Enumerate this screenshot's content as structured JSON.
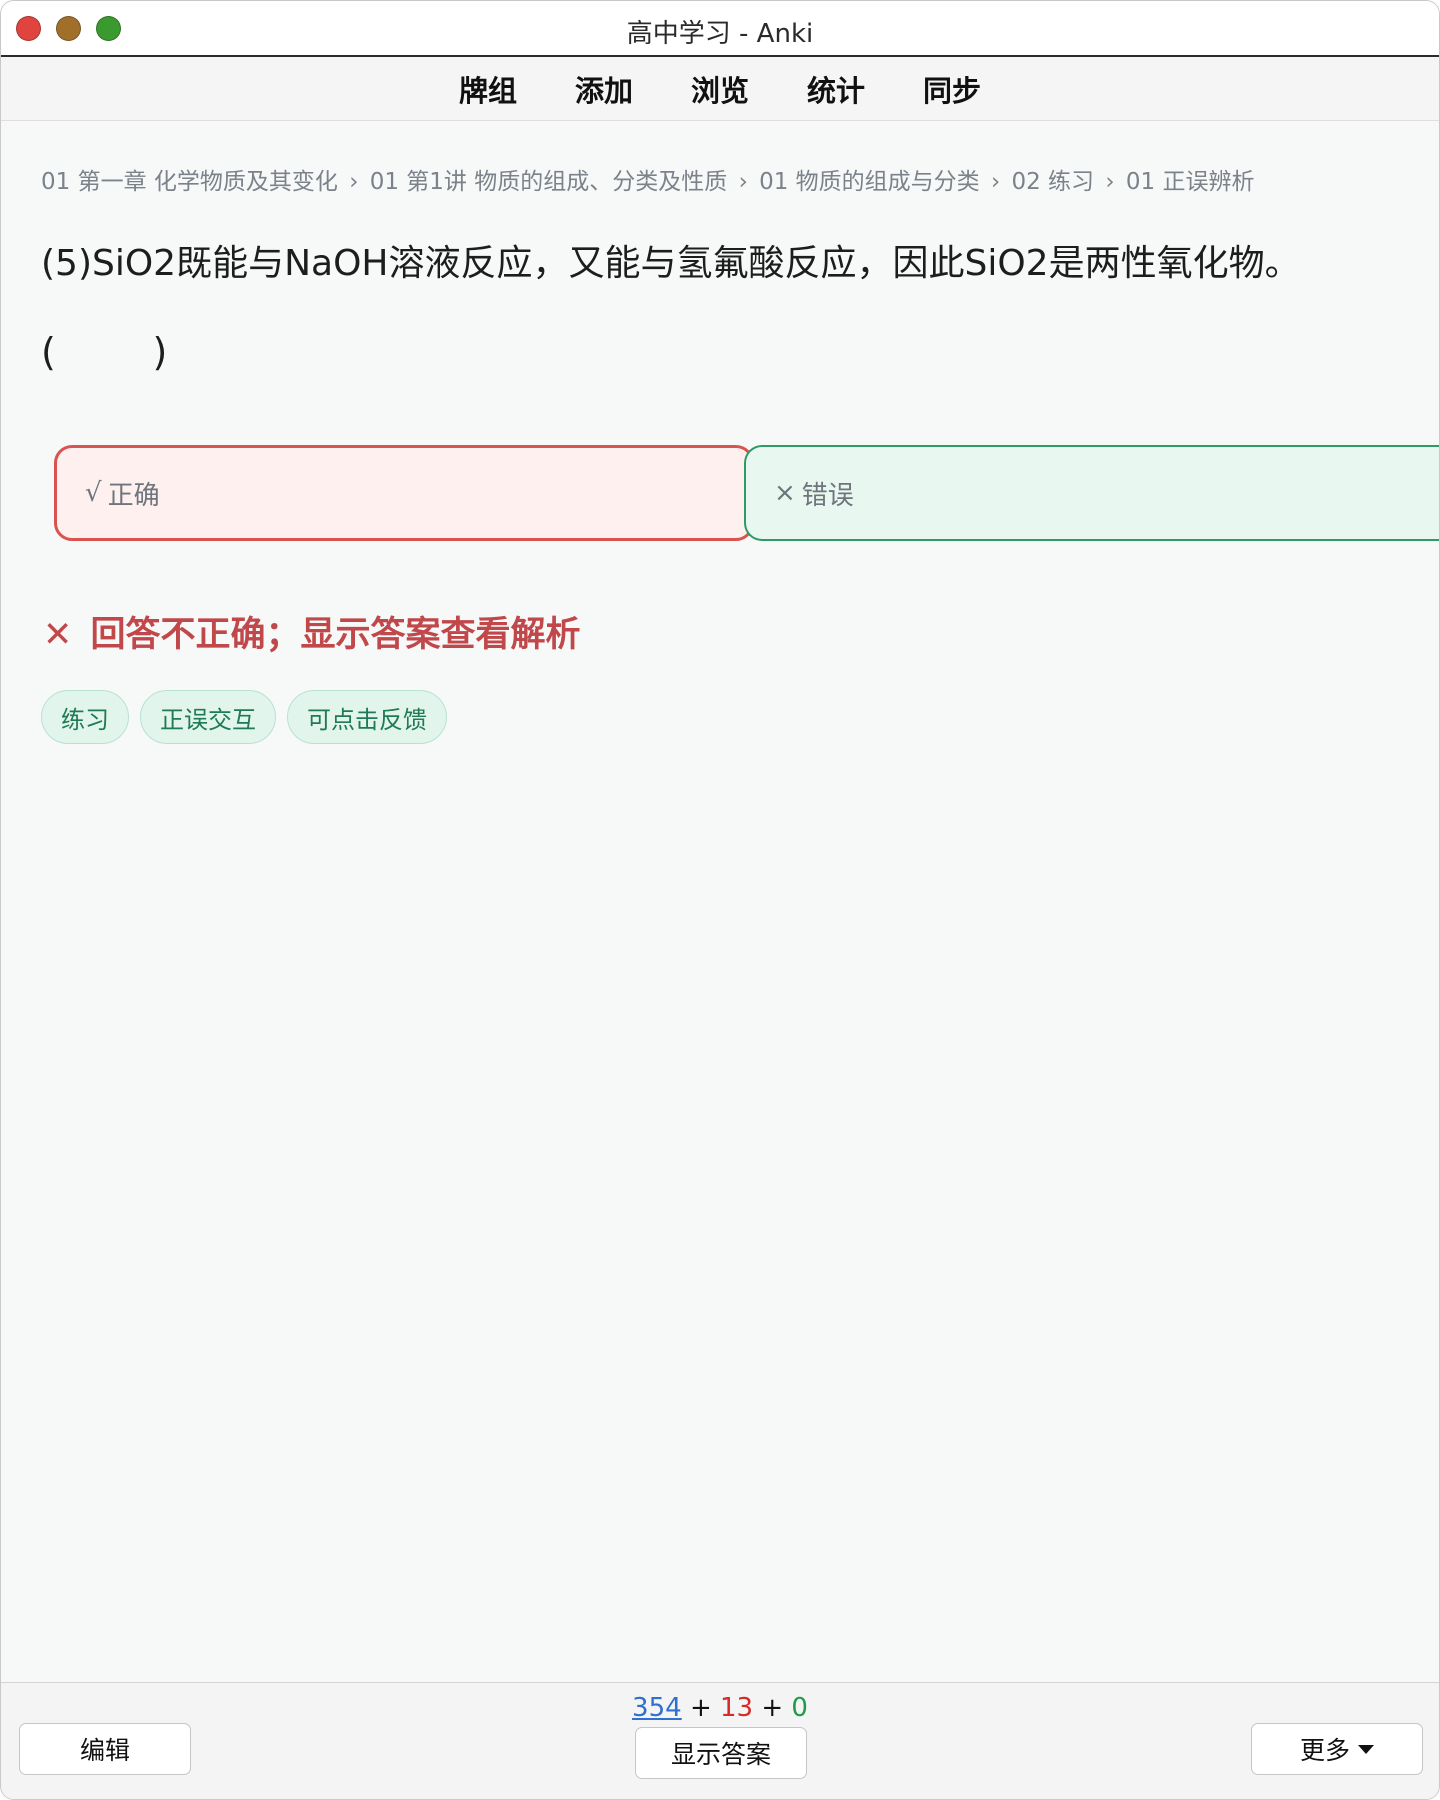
{
  "window": {
    "title": "高中学习 - Anki"
  },
  "toolbar": {
    "items": [
      "牌组",
      "添加",
      "浏览",
      "统计",
      "同步"
    ]
  },
  "card": {
    "breadcrumb": [
      "01 第一章 化学物质及其变化",
      "01 第1讲 物质的组成、分类及性质",
      "01 物质的组成与分类",
      "02 练习",
      "01 正误辨析"
    ],
    "breadcrumb_separator": "›",
    "question": "(5)SiO2既能与NaOH溶液反应，又能与氢氟酸反应，因此SiO2是两性氧化物。",
    "blank": "(        )",
    "choices": {
      "correct": {
        "glyph": "√",
        "label": "正确"
      },
      "wrong": {
        "glyph": "×",
        "label": "错误"
      }
    },
    "feedback": {
      "icon": "✕",
      "text": "回答不正确；显示答案查看解析"
    },
    "tags": [
      "练习",
      "正误交互",
      "可点击反馈"
    ]
  },
  "bottombar": {
    "edit_label": "编辑",
    "show_answer_label": "显示答案",
    "more_label": "更多",
    "counts": {
      "new": "354",
      "learn": "13",
      "review": "0",
      "plus": "+"
    }
  },
  "colors": {
    "wrong_border": "#d9534f",
    "right_border": "#2e9a66",
    "feedback": "#c0474a",
    "new_count": "#2e6fd1",
    "learn_count": "#d42a2a",
    "review_count": "#1f9a4c"
  }
}
